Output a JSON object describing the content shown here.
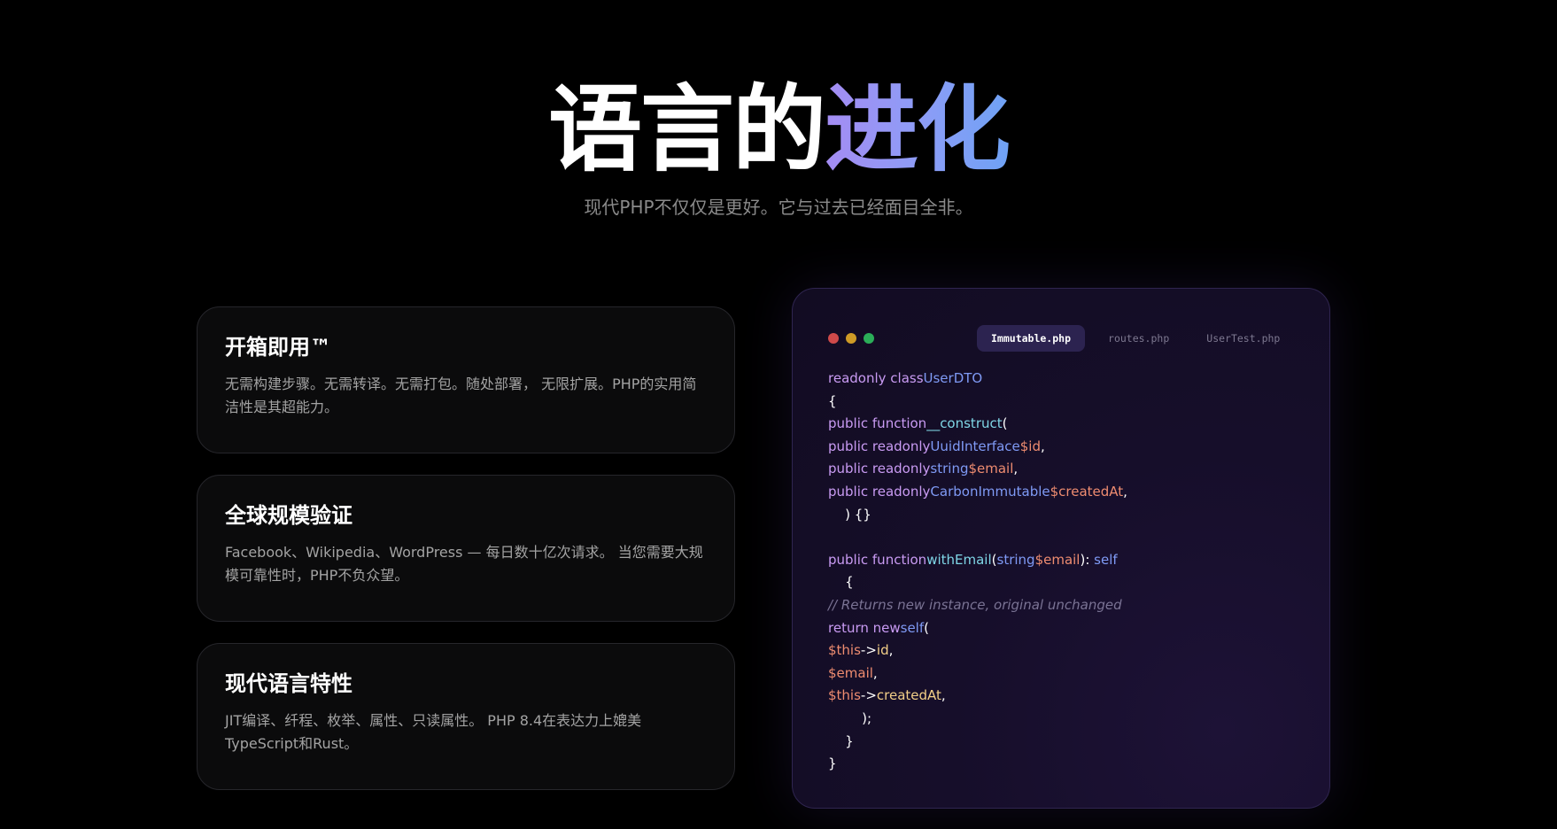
{
  "hero": {
    "title_plain": "语言的",
    "title_accent": "进化",
    "subtitle": "现代PHP不仅仅是更好。它与过去已经面目全非。"
  },
  "features": [
    {
      "title": "开箱即用™",
      "description": "无需构建步骤。无需转译。无需打包。随处部署， 无限扩展。PHP的实用简洁性是其超能力。"
    },
    {
      "title": "全球规模验证",
      "description": "Facebook、Wikipedia、WordPress — 每日数十亿次请求。 当您需要大规模可靠性时，PHP不负众望。"
    },
    {
      "title": "现代语言特性",
      "description": "JIT编译、纤程、枚举、属性、只读属性。 PHP 8.4在表达力上媲美TypeScript和Rust。"
    }
  ],
  "code_window": {
    "window_controls": [
      "close-dot",
      "minimize-dot",
      "maximize-dot"
    ],
    "tabs": [
      {
        "label": "Immutable.php",
        "active": true
      },
      {
        "label": "routes.php",
        "active": false
      },
      {
        "label": "UserTest.php",
        "active": false
      }
    ],
    "code_tokens": {
      "l1": [
        "readonly class",
        "UserDTO"
      ],
      "l2": [
        "{"
      ],
      "l3": [
        "public function",
        "__construct",
        "("
      ],
      "l4": [
        "public readonly",
        "UuidInterface",
        "$id",
        ","
      ],
      "l5": [
        "public readonly",
        "string",
        "$email",
        ","
      ],
      "l6": [
        "public readonly",
        "CarbonImmutable",
        "$createdAt",
        ","
      ],
      "l7": [
        "    ) {}"
      ],
      "l9": [
        "public function",
        "withEmail",
        "(",
        "string",
        "$email",
        "): ",
        "self"
      ],
      "l10": [
        "    {"
      ],
      "l11": [
        "// Returns new instance, original unchanged"
      ],
      "l12": [
        "return new",
        "self",
        "("
      ],
      "l13": [
        "$this",
        "->",
        "id",
        ","
      ],
      "l14": [
        "$email",
        ","
      ],
      "l15": [
        "$this",
        "->",
        "createdAt",
        ","
      ],
      "l16": [
        "        );"
      ],
      "l17": [
        "    }"
      ],
      "l18": [
        "}"
      ]
    },
    "colors": {
      "keyword": "#c99bf3",
      "type": "#7f9af5",
      "variable": "#ee8c70",
      "function": "#7fd6e6",
      "property": "#f3cf88",
      "comment": "#7a7394"
    }
  },
  "colors": {
    "background": "#000000",
    "accent_start": "#a48cf3",
    "accent_end": "#6fa2f5",
    "card_bg": "#0b0b0c",
    "code_bg": "#160e2a"
  }
}
